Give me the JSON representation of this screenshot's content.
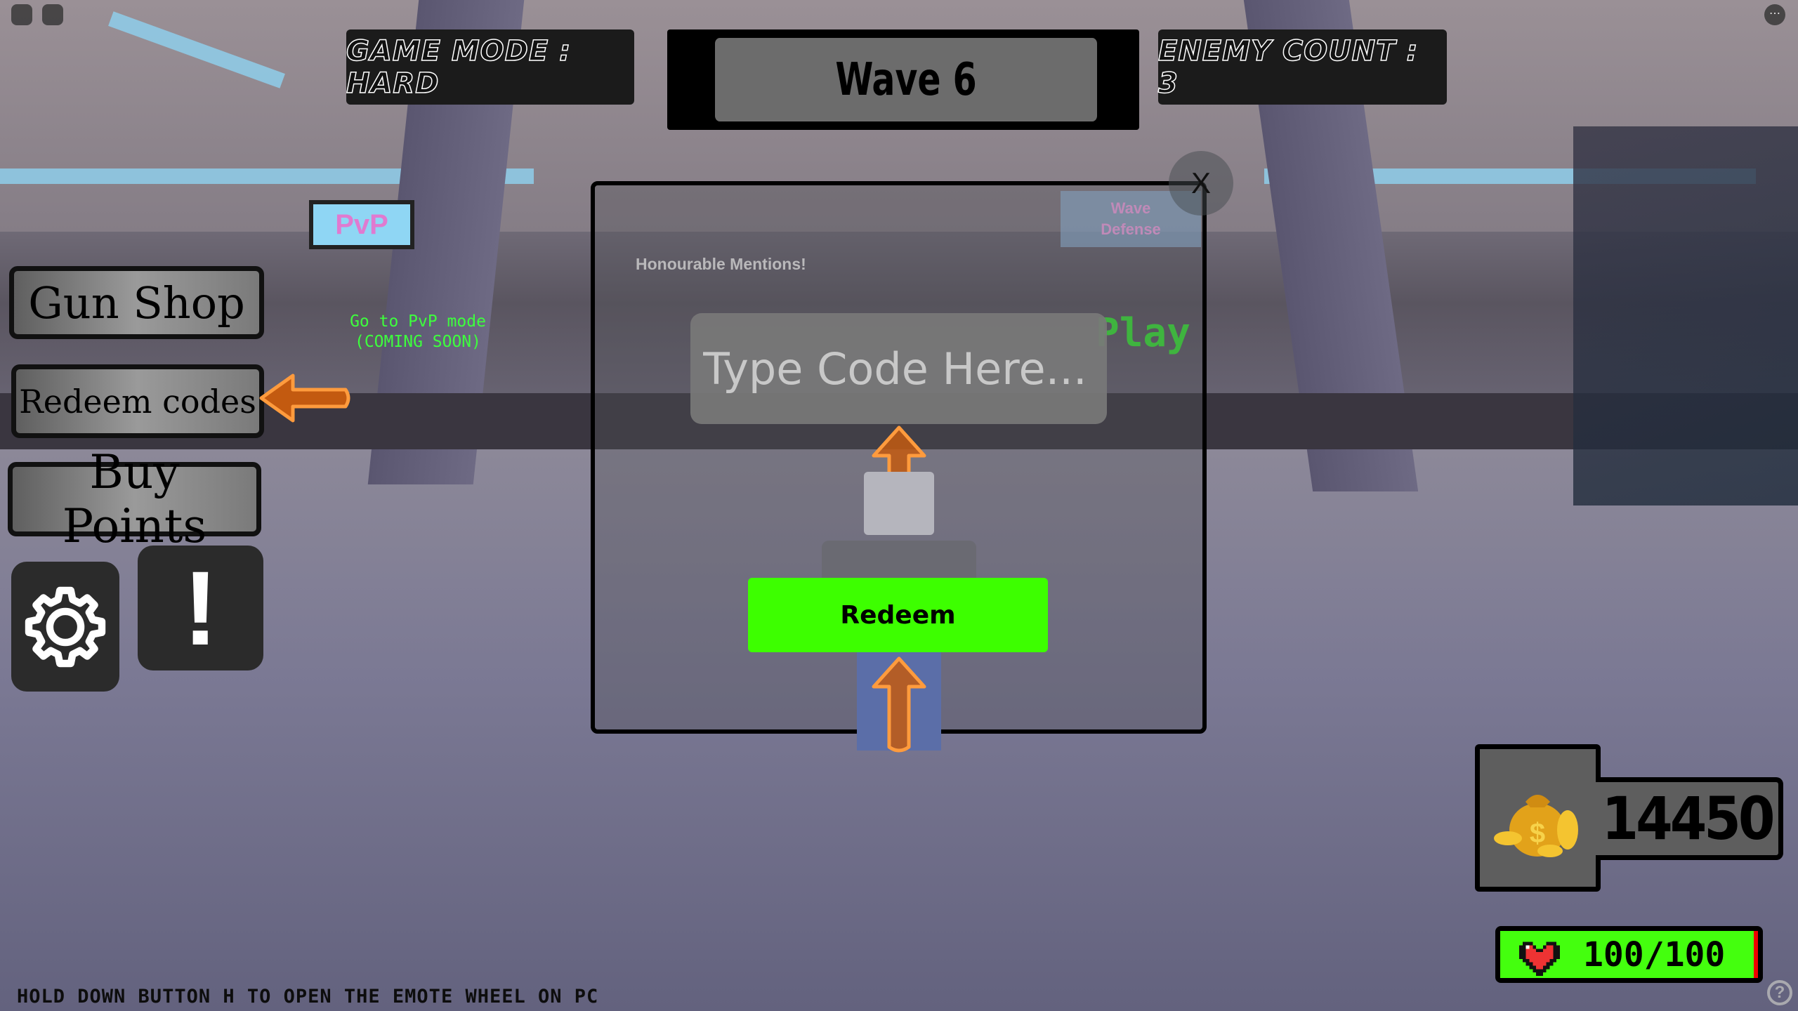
{
  "hud": {
    "game_mode": "Game Mode : Hard",
    "wave": "Wave 6",
    "enemy_count": "Enemy Count : 3"
  },
  "side_menu": {
    "gun_shop": "Gun Shop",
    "redeem_codes": "Redeem codes",
    "buy_points": "Buy Points",
    "settings_icon": "gear-icon",
    "alert_icon": "exclamation-icon",
    "alert_label": "!"
  },
  "world_text": {
    "pvp_hint_line1": "Go to PvP mode",
    "pvp_hint_line2": "(COMING SOON)",
    "pvp_sign": "PvP",
    "honourable": "Honourable Mentions!",
    "wave_defense_line1": "Wave",
    "wave_defense_line2": "Defense",
    "play": "Play"
  },
  "redeem_modal": {
    "close_label": "X",
    "input_placeholder": "Type Code Here...",
    "input_value": "",
    "redeem_button": "Redeem"
  },
  "stats": {
    "points": "14450",
    "health": "100/100",
    "health_fraction": 1.0
  },
  "footer_hint": "HOLD DOWN BUTTON H TO OPEN THE EMOTE WHEEL ON PC",
  "colors": {
    "accent_green": "#3dff00",
    "arrow_orange": "#d9671c",
    "panel_gray": "#6c6c6c"
  }
}
